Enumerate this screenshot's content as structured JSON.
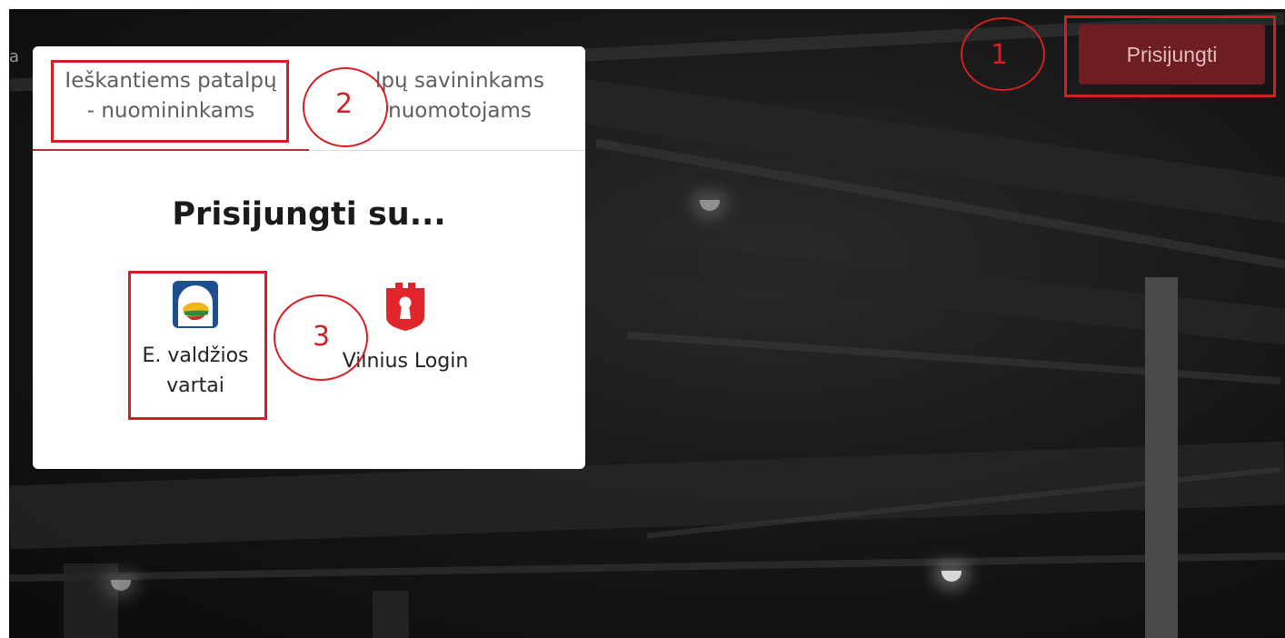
{
  "header": {
    "login_button": "Prisijungti",
    "partial_text": "a"
  },
  "login_panel": {
    "tabs": [
      {
        "label": "Ieškantiems patalpų - nuomininkams",
        "active": true
      },
      {
        "label": "...lpų savininkams ...nuomotojams",
        "active": false
      }
    ],
    "tab1_line1": "Ieškantiems patalpų",
    "tab1_line2": "- nuomininkams",
    "tab2_line1": "lpų savininkams",
    "tab2_line2": "nuomotojams",
    "heading": "Prisijungti su...",
    "providers": {
      "evv_line1": "E. valdžios",
      "evv_line2": "vartai",
      "evv_icon": "e-government-gateway-icon",
      "vilnius_label": "Vilnius Login",
      "vilnius_icon": "vilnius-login-icon"
    }
  },
  "annotations": {
    "n1": "1",
    "n2": "2",
    "n3": "3"
  },
  "colors": {
    "accent": "#6e1e21",
    "annotation": "#d31f23",
    "active_tab": "#b03034"
  }
}
